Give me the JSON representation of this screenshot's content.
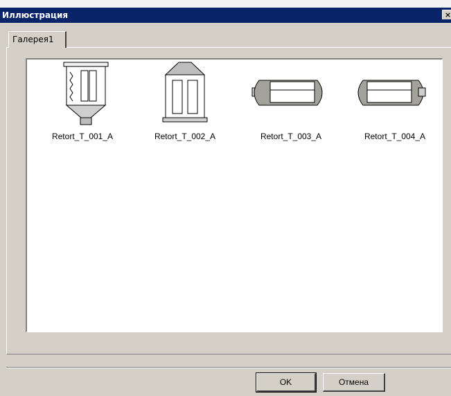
{
  "window": {
    "title": "Иллюстрация",
    "close_glyph": "×"
  },
  "tabs": [
    {
      "label": "Галерея1",
      "selected": true
    }
  ],
  "gallery": {
    "items": [
      {
        "label": "Retort_T_001_A",
        "icon": "retort-hopper-icon"
      },
      {
        "label": "Retort_T_002_A",
        "icon": "retort-dome-icon"
      },
      {
        "label": "Retort_T_003_A",
        "icon": "retort-horizontal-icon"
      },
      {
        "label": "Retort_T_004_A",
        "icon": "retort-horizontal-icon"
      }
    ]
  },
  "buttons": {
    "ok": "OK",
    "cancel": "Отмена"
  },
  "colors": {
    "titlebar": "#0a246a",
    "dialog_bg": "#d4d0c8",
    "gallery_bg": "#ffffff"
  }
}
